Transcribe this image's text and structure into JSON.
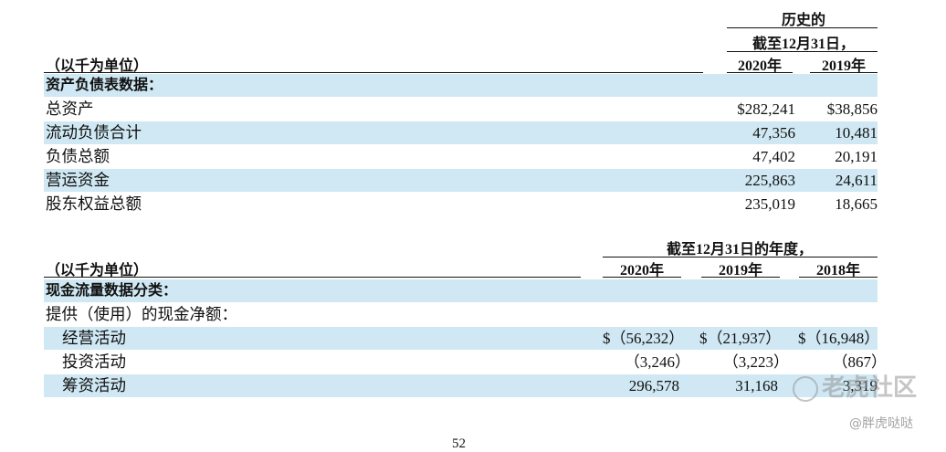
{
  "balance": {
    "unit_label": "（以千为单位）",
    "group_header": "历史的",
    "date_header": "截至12月31日，",
    "years": [
      "2020年",
      "2019年"
    ],
    "section_title": "资产负债表数据：",
    "rows": [
      {
        "label": "总资产",
        "v2020": "$282,241",
        "v2019": "$38,856"
      },
      {
        "label": "流动负债合计",
        "v2020": "47,356",
        "v2019": "10,481"
      },
      {
        "label": "负债总额",
        "v2020": "47,402",
        "v2019": "20,191"
      },
      {
        "label": "营运资金",
        "v2020": "225,863",
        "v2019": "24,611"
      },
      {
        "label": "股东权益总额",
        "v2020": "235,019",
        "v2019": "18,665"
      }
    ]
  },
  "cashflow": {
    "unit_label": "（以千为单位）",
    "date_header": "截至12月31日的年度，",
    "years": [
      "2020年",
      "2019年",
      "2018年"
    ],
    "section_title": "现金流量数据分类：",
    "subheading": "提供（使用）的现金净额：",
    "rows": [
      {
        "label": "经营活动",
        "v2020": "$（56,232）",
        "v2019": "$（21,937）",
        "v2018": "$（16,948）"
      },
      {
        "label": "投资活动",
        "v2020": "（3,246）",
        "v2019": "（3,223）",
        "v2018": "（867）"
      },
      {
        "label": "筹资活动",
        "v2020": "296,578",
        "v2019": "31,168",
        "v2018": "3,319"
      }
    ]
  },
  "watermark": {
    "brand": "老虎社区",
    "handle": "@胖虎哒哒"
  },
  "page_number": "52"
}
